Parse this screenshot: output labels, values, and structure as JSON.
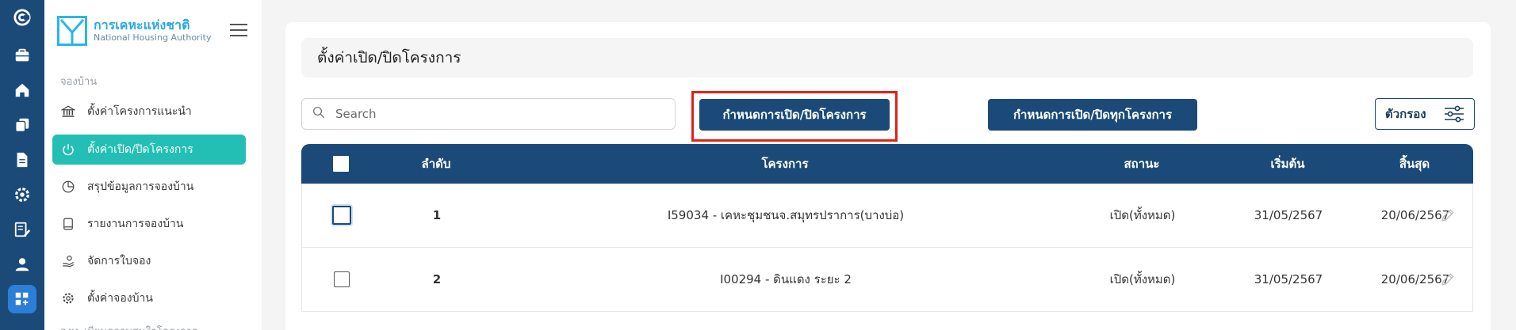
{
  "rail": {
    "items": [
      {
        "icon": "app-logo-icon"
      },
      {
        "icon": "briefcase-icon"
      },
      {
        "icon": "home-icon"
      },
      {
        "icon": "copy-icon"
      },
      {
        "icon": "document-icon"
      },
      {
        "icon": "settings-icon"
      },
      {
        "icon": "edit-list-icon"
      },
      {
        "icon": "user-icon"
      },
      {
        "icon": "grid-add-icon",
        "active": true
      }
    ],
    "colors": {
      "background": "#1b4a78",
      "active": "#2c7fd6"
    }
  },
  "sidebar": {
    "logo": {
      "title_th": "การเคหะแห่งชาติ",
      "title_en": "National Housing Authority"
    },
    "section_label": "จองบ้าน",
    "items": [
      {
        "label": "ตั้งค่าโครงการแนะนำ",
        "icon": "bank-icon"
      },
      {
        "label": "ตั้งค่าเปิด/ปิดโครงการ",
        "icon": "power-icon",
        "active": true
      },
      {
        "label": "สรุปข้อมูลการจองบ้าน",
        "icon": "pie-chart-icon"
      },
      {
        "label": "รายงานการจองบ้าน",
        "icon": "book-icon"
      },
      {
        "label": "จัดการใบจอง",
        "icon": "hand-coin-icon"
      },
      {
        "label": "ตั้งค่าจองบ้าน",
        "icon": "gear-icon"
      }
    ],
    "cutoff_label": "ลงทะเบียนความสนใจโครงการ",
    "active_color": "#23bfb5"
  },
  "main": {
    "page_title": "ตั้งค่าเปิด/ปิดโครงการ",
    "search": {
      "placeholder": "Search",
      "value": ""
    },
    "buttons": {
      "set_open_close": "กำหนดการเปิด/ปิดโครงการ",
      "set_open_close_all": "กำหนดการเปิด/ปิดทุกโครงการ",
      "filter": "ตัวกรอง"
    },
    "highlight_color": "#e0201b",
    "table": {
      "headers": {
        "no": "ลำดับ",
        "project": "โครงการ",
        "status": "สถานะ",
        "start": "เริ่มต้น",
        "end": "สิ้นสุด"
      },
      "rows": [
        {
          "no": "1",
          "project": "I59034 - เคหะชุมชนจ.สมุทรปราการ(บางบ่อ)",
          "status": "เปิด(ทั้งหมด)",
          "start": "31/05/2567",
          "end": "20/06/2567"
        },
        {
          "no": "2",
          "project": "I00294 - ดินแดง ระยะ 2",
          "status": "เปิด(ทั้งหมด)",
          "start": "31/05/2567",
          "end": "20/06/2567"
        }
      ],
      "header_color": "#1b4a78"
    }
  }
}
